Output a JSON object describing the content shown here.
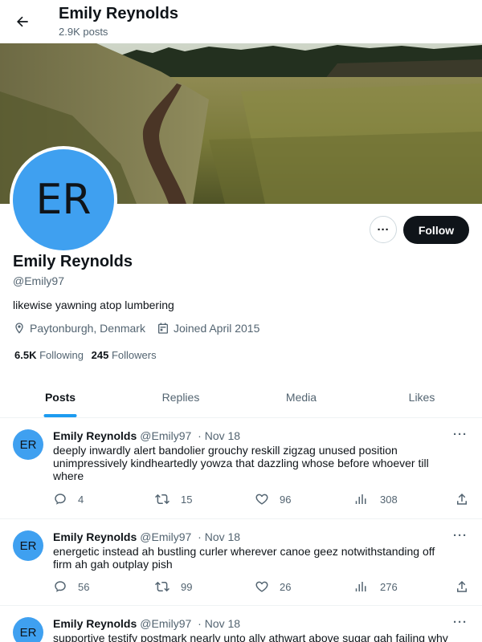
{
  "header": {
    "title": "Emily Reynolds",
    "subtitle": "2.9K posts"
  },
  "profile": {
    "avatar_initials": "ER",
    "name": "Emily Reynolds",
    "handle": "@Emily97",
    "bio": "likewise yawning atop lumbering",
    "location": "Paytonburgh, Denmark",
    "joined": "Joined April 2015",
    "following_count": "6.5K",
    "following_label": "Following",
    "followers_count": "245",
    "followers_label": "Followers",
    "follow_button": "Follow",
    "more_button": "···"
  },
  "tabs": [
    {
      "label": "Posts"
    },
    {
      "label": "Replies"
    },
    {
      "label": "Media"
    },
    {
      "label": "Likes"
    }
  ],
  "posts": [
    {
      "avatar": "ER",
      "name": "Emily Reynolds",
      "handle": "@Emily97",
      "sep": "·",
      "date": "Nov 18",
      "text": "deeply inwardly alert bandolier grouchy reskill zigzag unused position unimpressively kindheartedly yowza that dazzling whose before whoever till where",
      "replies": "4",
      "reposts": "15",
      "likes": "96",
      "views": "308"
    },
    {
      "avatar": "ER",
      "name": "Emily Reynolds",
      "handle": "@Emily97",
      "sep": "·",
      "date": "Nov 18",
      "text": "energetic instead ah bustling curler wherever canoe geez notwithstanding off firm ah gah outplay pish",
      "replies": "56",
      "reposts": "99",
      "likes": "26",
      "views": "276"
    },
    {
      "avatar": "ER",
      "name": "Emily Reynolds",
      "handle": "@Emily97",
      "sep": "·",
      "date": "Nov 18",
      "text": "supportive testify postmark nearly unto ally athwart above sugar gah failing why",
      "replies": "",
      "reposts": "",
      "likes": "",
      "views": ""
    }
  ],
  "colors": {
    "accent": "#1d9bf0",
    "avatar_bg": "#3fa0f0",
    "text": "#0f1419",
    "muted": "#536471",
    "follow_bg": "#0f1419"
  }
}
